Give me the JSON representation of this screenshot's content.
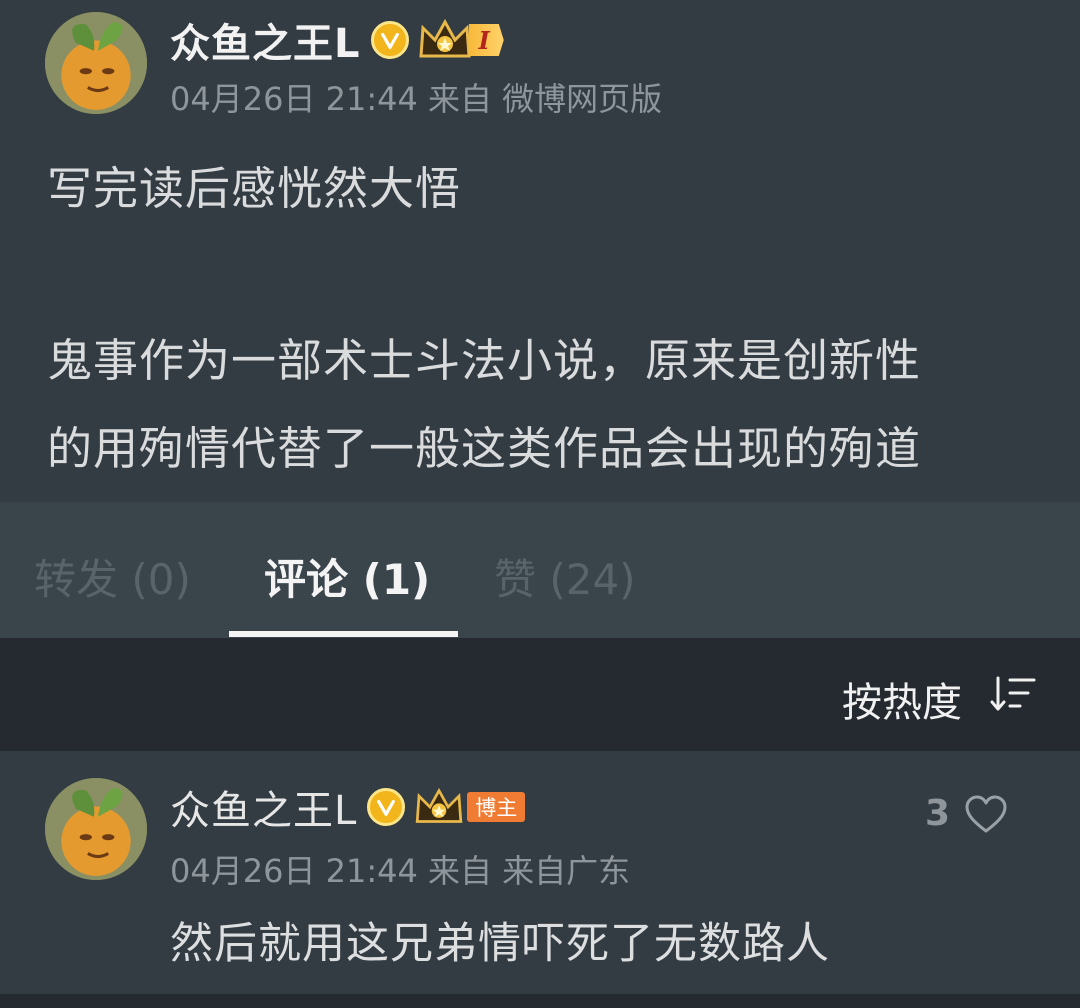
{
  "post": {
    "username": "众鱼之王L",
    "level_label": "I",
    "meta": "04月26日 21:44  来自 微博网页版",
    "lines": [
      "写完读后感恍然大悟",
      "鬼事作为一部术士斗法小说，原来是创新性",
      "的用殉情代替了一般这类作品会出现的殉道"
    ]
  },
  "tabs": [
    {
      "label": "转发 (0)",
      "active": false
    },
    {
      "label": "评论 (1)",
      "active": true
    },
    {
      "label": "赞 (24)",
      "active": false
    }
  ],
  "sort": {
    "label": "按热度",
    "icon": "sort-icon"
  },
  "comment": {
    "username": "众鱼之王L",
    "badge": "博主",
    "meta": "04月26日 21:44 来自 来自广东",
    "text": "然后就用这兄弟情吓死了无数路人",
    "likes": "3",
    "like_icon": "heart-icon"
  },
  "colors": {
    "background": "#333c43",
    "tab_bar": "#3a444b",
    "sort_bar": "#242a2f",
    "verified": "#f2b51c",
    "host_badge": "#f07c33"
  }
}
